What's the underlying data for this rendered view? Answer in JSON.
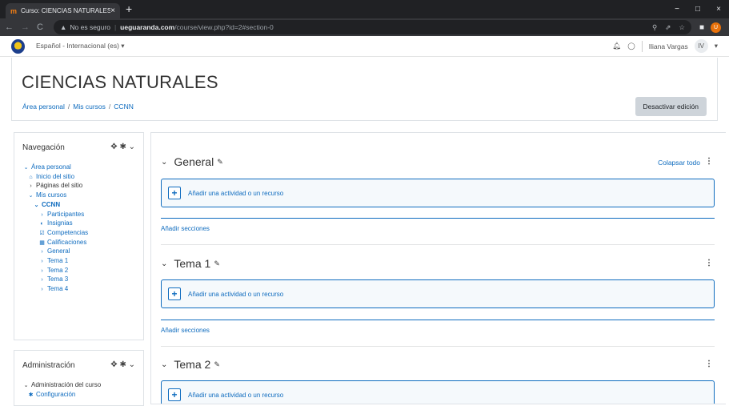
{
  "browser": {
    "tab_title": "Curso: CIENCIAS NATURALES",
    "tab_close": "×",
    "new_tab": "+",
    "win_min": "−",
    "win_max": "□",
    "win_close": "×",
    "back": "←",
    "forward": "→",
    "reload": "C",
    "security_label": "No es seguro",
    "url_host": "ueguaranda.com",
    "url_path": "/course/view.php?id=2#section-0",
    "profile_initial": "U"
  },
  "topnav": {
    "language": "Español - Internacional (es) ▾",
    "user_name": "Iliana Vargas",
    "avatar_initials": "IV",
    "user_menu_caret": "▾"
  },
  "page": {
    "title": "CIENCIAS NATURALES",
    "breadcrumb": [
      "Área personal",
      "Mis cursos",
      "CCNN"
    ],
    "breadcrumb_sep": "/",
    "edit_button": "Desactivar edición"
  },
  "nav_block": {
    "title": "Navegación",
    "controls": "✥ ✱ ⌄",
    "items": [
      {
        "label": "Área personal",
        "icon": "⌄"
      },
      {
        "label": "Inicio del sitio",
        "icon": "🏠"
      },
      {
        "label": "Páginas del sitio",
        "icon": "›"
      },
      {
        "label": "Mis cursos",
        "icon": "⌄"
      },
      {
        "label": "CCNN",
        "icon": "⌄"
      },
      {
        "label": "Participantes",
        "icon": "›"
      },
      {
        "label": "Insignias",
        "icon": "◐"
      },
      {
        "label": "Competencias",
        "icon": "☑"
      },
      {
        "label": "Calificaciones",
        "icon": "▦"
      },
      {
        "label": "General",
        "icon": "›"
      },
      {
        "label": "Tema 1",
        "icon": "›"
      },
      {
        "label": "Tema 2",
        "icon": "›"
      },
      {
        "label": "Tema 3",
        "icon": "›"
      },
      {
        "label": "Tema 4",
        "icon": "›"
      }
    ]
  },
  "admin_block": {
    "title": "Administración",
    "controls": "✥ ✱ ⌄",
    "items": [
      {
        "label": "Administración del curso",
        "icon": "⌄"
      },
      {
        "label": "Configuración",
        "icon": "✱"
      }
    ]
  },
  "course": {
    "collapse_all": "Colapsar todo",
    "chevron": "⌄",
    "pencil": "✎",
    "kebab": "⋮",
    "add_activity": "Añadir una actividad o un recurso",
    "add_sections": "Añadir secciones",
    "sections": [
      {
        "title": "General"
      },
      {
        "title": "Tema 1"
      },
      {
        "title": "Tema 2"
      }
    ]
  },
  "colors": {
    "link": "#0f6cbf",
    "browser_dark": "#202124"
  }
}
